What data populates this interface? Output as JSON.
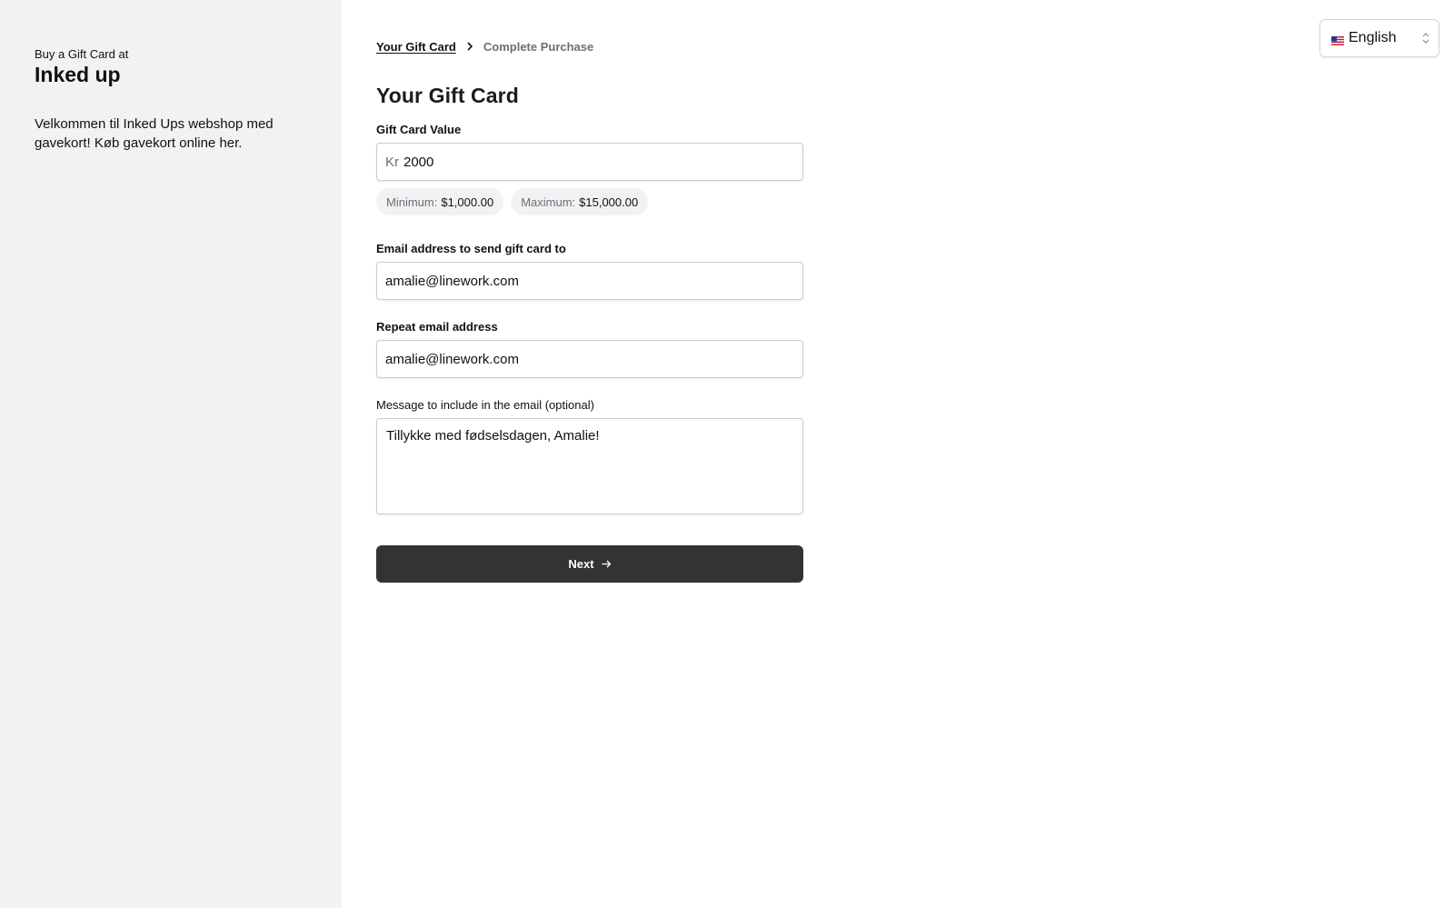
{
  "sidebar": {
    "pre_title": "Buy a Gift Card at",
    "shop_name": "Inked up",
    "welcome": "Velkommen til Inked Ups webshop med gavekort! Køb gavekort online her."
  },
  "breadcrumb": {
    "step1": "Your Gift Card",
    "step2": "Complete Purchase"
  },
  "language": {
    "label": "English",
    "icon": "us-flag-icon"
  },
  "form": {
    "title": "Your Gift Card",
    "value": {
      "label": "Gift Card Value",
      "prefix": "Kr",
      "amount": "2000",
      "min_key": "Minimum:",
      "min_value": "$1,000.00",
      "max_key": "Maximum:",
      "max_value": "$15,000.00"
    },
    "email": {
      "label": "Email address to send gift card to",
      "value": "amalie@linework.com"
    },
    "repeat_email": {
      "label": "Repeat email address",
      "value": "amalie@linework.com"
    },
    "message": {
      "label": "Message to include in the email (optional)",
      "value": "Tillykke med fødselsdagen, Amalie!"
    },
    "next_label": "Next",
    "next_icon": "arrow-right-icon"
  },
  "colors": {
    "sidebar_bg": "#f1f2f3",
    "button_bg": "#333333"
  }
}
